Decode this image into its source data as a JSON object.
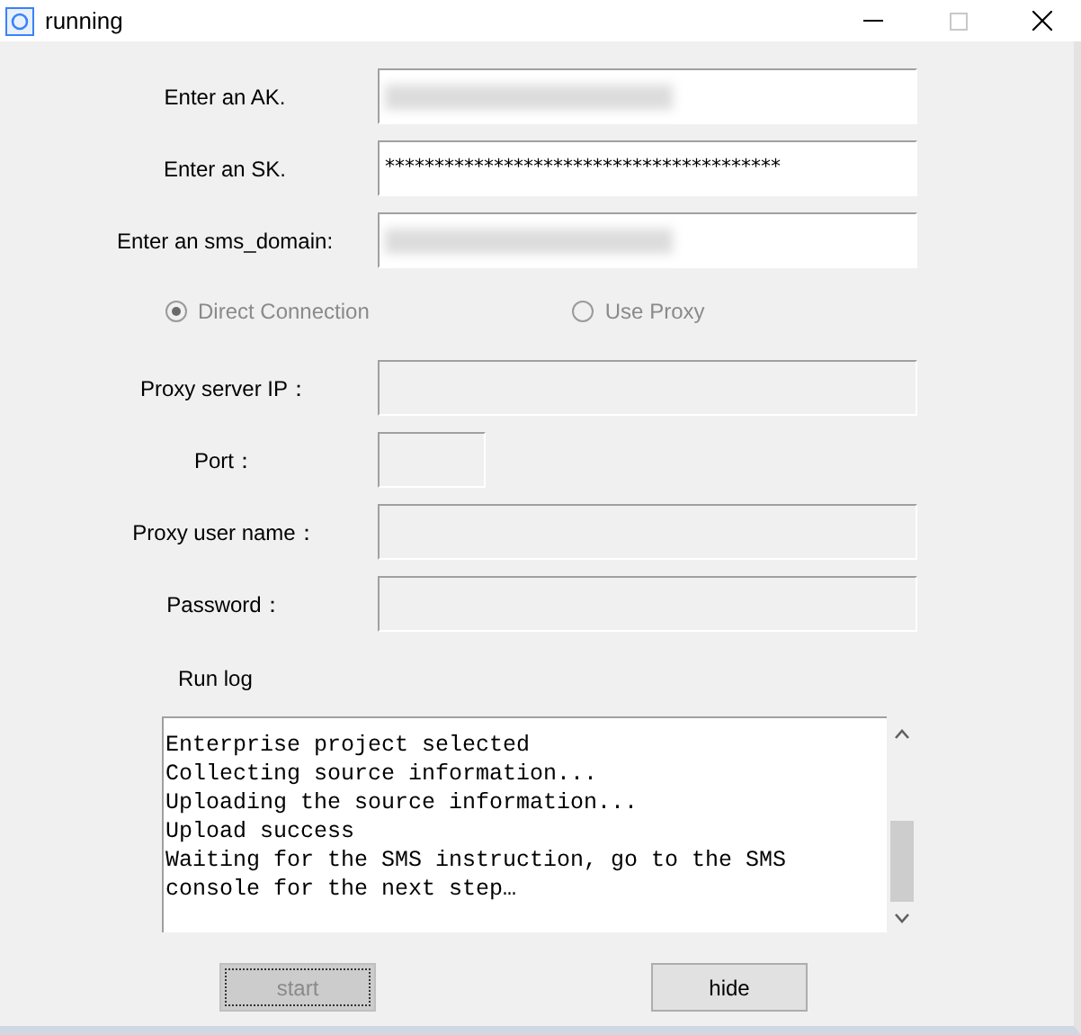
{
  "window": {
    "title": "running"
  },
  "credential_fields": [
    {
      "label": "Enter an AK.",
      "kind": "redacted",
      "disabled": false
    },
    {
      "label": "Enter an SK.",
      "kind": "masked",
      "value": "****************************************",
      "disabled": false
    },
    {
      "label": "Enter an sms_domain:",
      "kind": "redacted",
      "disabled": false
    }
  ],
  "connection_options": [
    {
      "label": "Direct Connection",
      "selected": true,
      "disabled": true
    },
    {
      "label": "Use Proxy",
      "selected": false,
      "disabled": true
    }
  ],
  "proxy_fields": [
    {
      "label": "Proxy server IP：",
      "kind": "wide",
      "disabled": true
    },
    {
      "label": "Port：",
      "kind": "short",
      "disabled": true
    },
    {
      "label": "Proxy user name：",
      "kind": "wide",
      "disabled": true
    },
    {
      "label": "Password：",
      "kind": "wide",
      "disabled": true
    }
  ],
  "run_log": {
    "label": "Run log",
    "lines": [
      "Enterprise project selected",
      "Collecting source information...",
      "Uploading the source information...",
      "Upload success",
      "Waiting for the SMS instruction, go to the SMS console for the next step…"
    ]
  },
  "buttons": [
    {
      "label": "start",
      "disabled": true
    },
    {
      "label": "hide",
      "disabled": false
    }
  ]
}
